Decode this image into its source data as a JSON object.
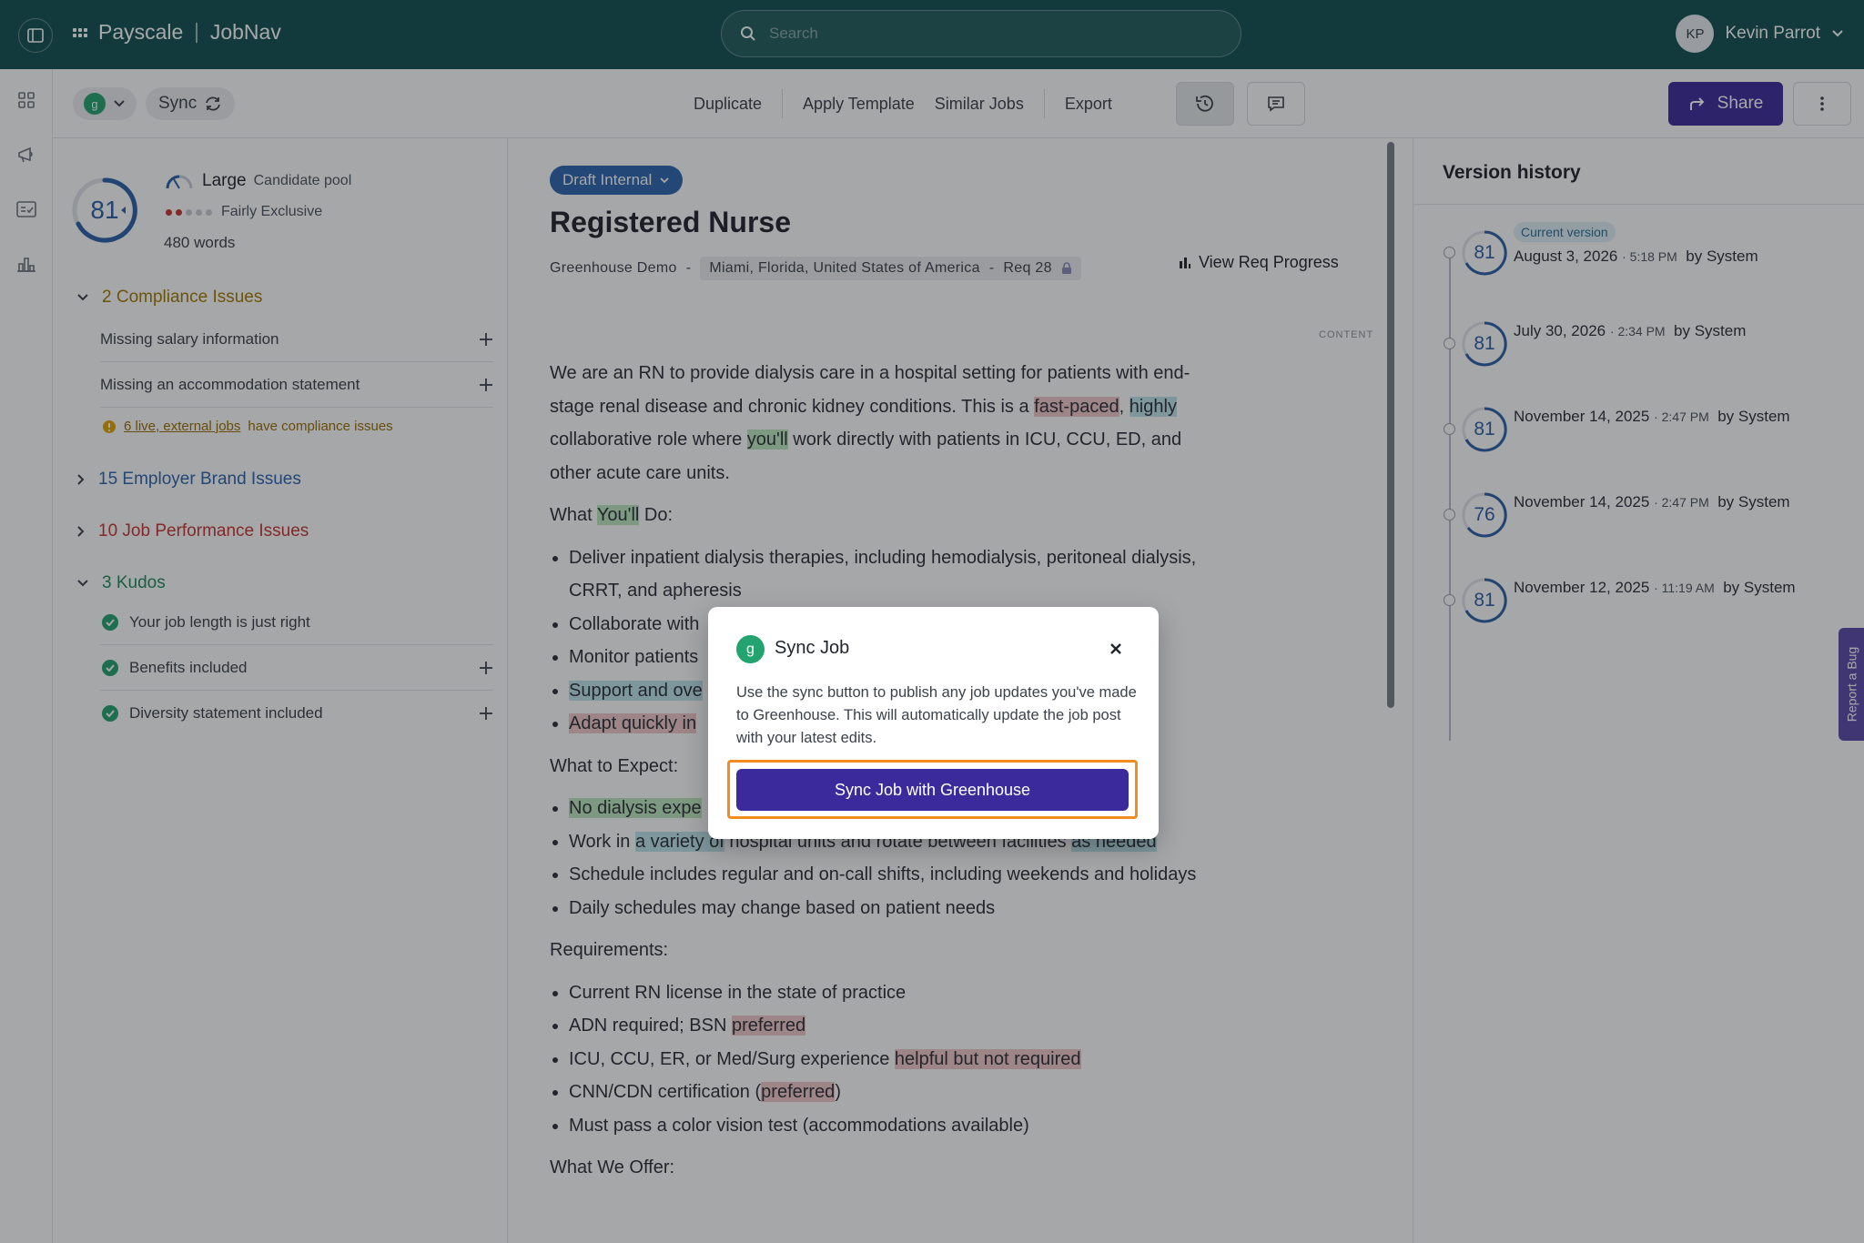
{
  "app": {
    "brand_name": "Payscale",
    "product_name": "JobNav",
    "search_placeholder": "Search",
    "user_initials": "KP",
    "user_name": "Kevin Parrot"
  },
  "toolbar": {
    "sync_label": "Sync",
    "actions": [
      "Duplicate",
      "Apply Template",
      "Similar Jobs",
      "Export"
    ],
    "share_label": "Share"
  },
  "score_panel": {
    "score": "81",
    "pool_size": "Large",
    "pool_label": "Candidate pool",
    "exclusivity": "Fairly Exclusive",
    "word_count": "480 words",
    "compliance_header": "2 Compliance Issues",
    "compliance_items": [
      "Missing salary information",
      "Missing an accommodation statement"
    ],
    "compliance_note_link": "6 live, external jobs",
    "compliance_note_rest": "have compliance issues",
    "brand_header": "15 Employer Brand Issues",
    "performance_header": "10 Job Performance Issues",
    "kudos_header": "3 Kudos",
    "kudos_items": [
      "Your job length is just right",
      "Benefits included",
      "Diversity statement included"
    ],
    "colors": {
      "compliance": "#a27a00",
      "brand": "#2d64ad",
      "performance": "#c8342f",
      "kudos": "#1f8a5b"
    }
  },
  "job": {
    "status": "Draft Internal",
    "title": "Registered Nurse",
    "company": "Greenhouse Demo",
    "location": "Miami, Florida, United States of America",
    "req": "Req 28",
    "view_progress": "View Req Progress",
    "content_tag": "CONTENT",
    "intro_1": "We are an RN to provide dialysis care in a hospital setting for patients with end-stage renal disease and chronic kidney conditions. This is a ",
    "intro_hl1": "fast-paced",
    "intro_2": ", ",
    "intro_hl2": "highly",
    "intro_3": " collaborative role where ",
    "intro_hl3": "you'll",
    "intro_4": " work directly with patients in ICU, CCU, ED, and other acute care units.",
    "wyd_1": "What ",
    "wyd_hl": "You'll",
    "wyd_2": " Do:",
    "do_1": "Deliver inpatient dialysis therapies, including hemodialysis, peritoneal dialysis, CRRT, and apheresis",
    "do_2": "Collaborate with",
    "do_3": "Monitor patients",
    "do_4": "Support and ove",
    "do_5": "Adapt quickly in",
    "expect_h": "What to Expect:",
    "exp_1": "No dialysis expe",
    "exp_2a": "Work in ",
    "exp_2hl": "a variety of",
    "exp_2b": " hospital units and rotate between facilities ",
    "exp_2hl2": "as needed",
    "exp_3": "Schedule includes regular and on-call shifts, including weekends and holidays",
    "exp_4": "Daily schedules may change based on patient needs",
    "req_h": "Requirements:",
    "req_1": "Current RN license in the state of practice",
    "req_2a": "ADN required; BSN ",
    "req_2hl": "preferred",
    "req_3a": "ICU, CCU, ER, or Med/Surg experience ",
    "req_3hl": "helpful but not required",
    "req_4a": "CNN/CDN certification (",
    "req_4hl": "preferred",
    "req_4b": ")",
    "req_5": "Must pass a color vision test (accommodations available)",
    "offer_h": "What We Offer:"
  },
  "versions": {
    "header": "Version history",
    "current_label": "Current version",
    "items": [
      {
        "score": "81",
        "date": "August 3, 2026",
        "time": "5:18 PM",
        "by": "by System"
      },
      {
        "score": "81",
        "date": "July 30, 2026",
        "time": "2:34 PM",
        "by": "by System"
      },
      {
        "score": "81",
        "date": "November 14, 2025",
        "time": "2:47 PM",
        "by": "by System"
      },
      {
        "score": "76",
        "date": "November 14, 2025",
        "time": "2:47 PM",
        "by": "by System"
      },
      {
        "score": "81",
        "date": "November 12, 2025",
        "time": "11:19 AM",
        "by": "by System"
      }
    ]
  },
  "report_bug": "Report a Bug",
  "modal": {
    "title": "Sync Job",
    "description": "Use the sync button to publish any job updates you've made to Greenhouse. This will automatically update the job post with your latest edits.",
    "button_label": "Sync Job with Greenhouse"
  }
}
